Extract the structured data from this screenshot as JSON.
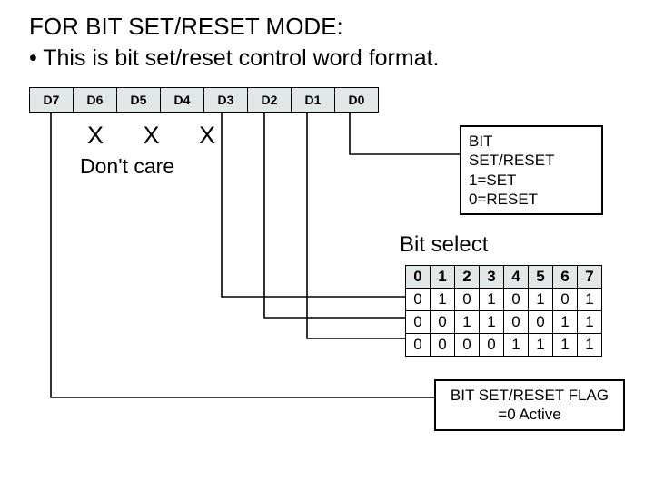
{
  "title": "FOR BIT SET/RESET MODE:",
  "bullet": "• This is bit set/reset control word format.",
  "bits": [
    "D7",
    "D6",
    "D5",
    "D4",
    "D3",
    "D2",
    "D1",
    "D0"
  ],
  "xxx": "X X X",
  "dontcare": "Don't care",
  "box_set_reset": {
    "l1": "BIT",
    "l2": "SET/RESET",
    "l3": "1=SET",
    "l4": "0=RESET"
  },
  "bit_select_label": "Bit select",
  "table": {
    "header": [
      "0",
      "1",
      "2",
      "3",
      "4",
      "5",
      "6",
      "7"
    ],
    "rows": [
      [
        "0",
        "1",
        "0",
        "1",
        "0",
        "1",
        "0",
        "1"
      ],
      [
        "0",
        "0",
        "1",
        "1",
        "0",
        "0",
        "1",
        "1"
      ],
      [
        "0",
        "0",
        "0",
        "0",
        "1",
        "1",
        "1",
        "1"
      ]
    ]
  },
  "flag_box": {
    "l1": "BIT SET/RESET FLAG",
    "l2": "=0 Active"
  },
  "chart_data": {
    "type": "table",
    "title": "Bit select",
    "columns": [
      "bit0",
      "bit1",
      "bit2",
      "bit3",
      "bit4",
      "bit5",
      "bit6",
      "bit7"
    ],
    "series": [
      {
        "name": "D1",
        "values": [
          0,
          1,
          0,
          1,
          0,
          1,
          0,
          1
        ]
      },
      {
        "name": "D2",
        "values": [
          0,
          0,
          1,
          1,
          0,
          0,
          1,
          1
        ]
      },
      {
        "name": "D3",
        "values": [
          0,
          0,
          0,
          0,
          1,
          1,
          1,
          1
        ]
      }
    ]
  }
}
